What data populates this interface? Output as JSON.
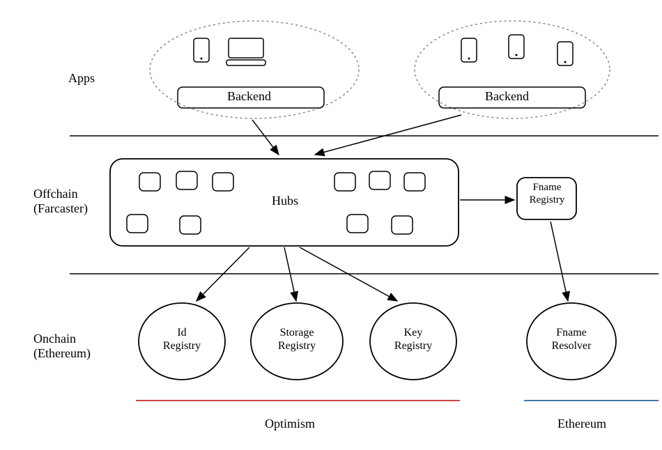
{
  "layers": {
    "apps": {
      "label": "Apps",
      "backend1": "Backend",
      "backend2": "Backend"
    },
    "offchain": {
      "label": "Offchain\n(Farcaster)",
      "hubs": "Hubs",
      "fname_registry": "Fname\nRegistry"
    },
    "onchain": {
      "label": "Onchain\n(Ethereum)",
      "id_registry": "Id\nRegistry",
      "storage_registry": "Storage\nRegistry",
      "key_registry": "Key\nRegistry",
      "fname_resolver": "Fname\nResolver"
    }
  },
  "chains": {
    "optimism": "Optimism",
    "ethereum": "Ethereum"
  }
}
